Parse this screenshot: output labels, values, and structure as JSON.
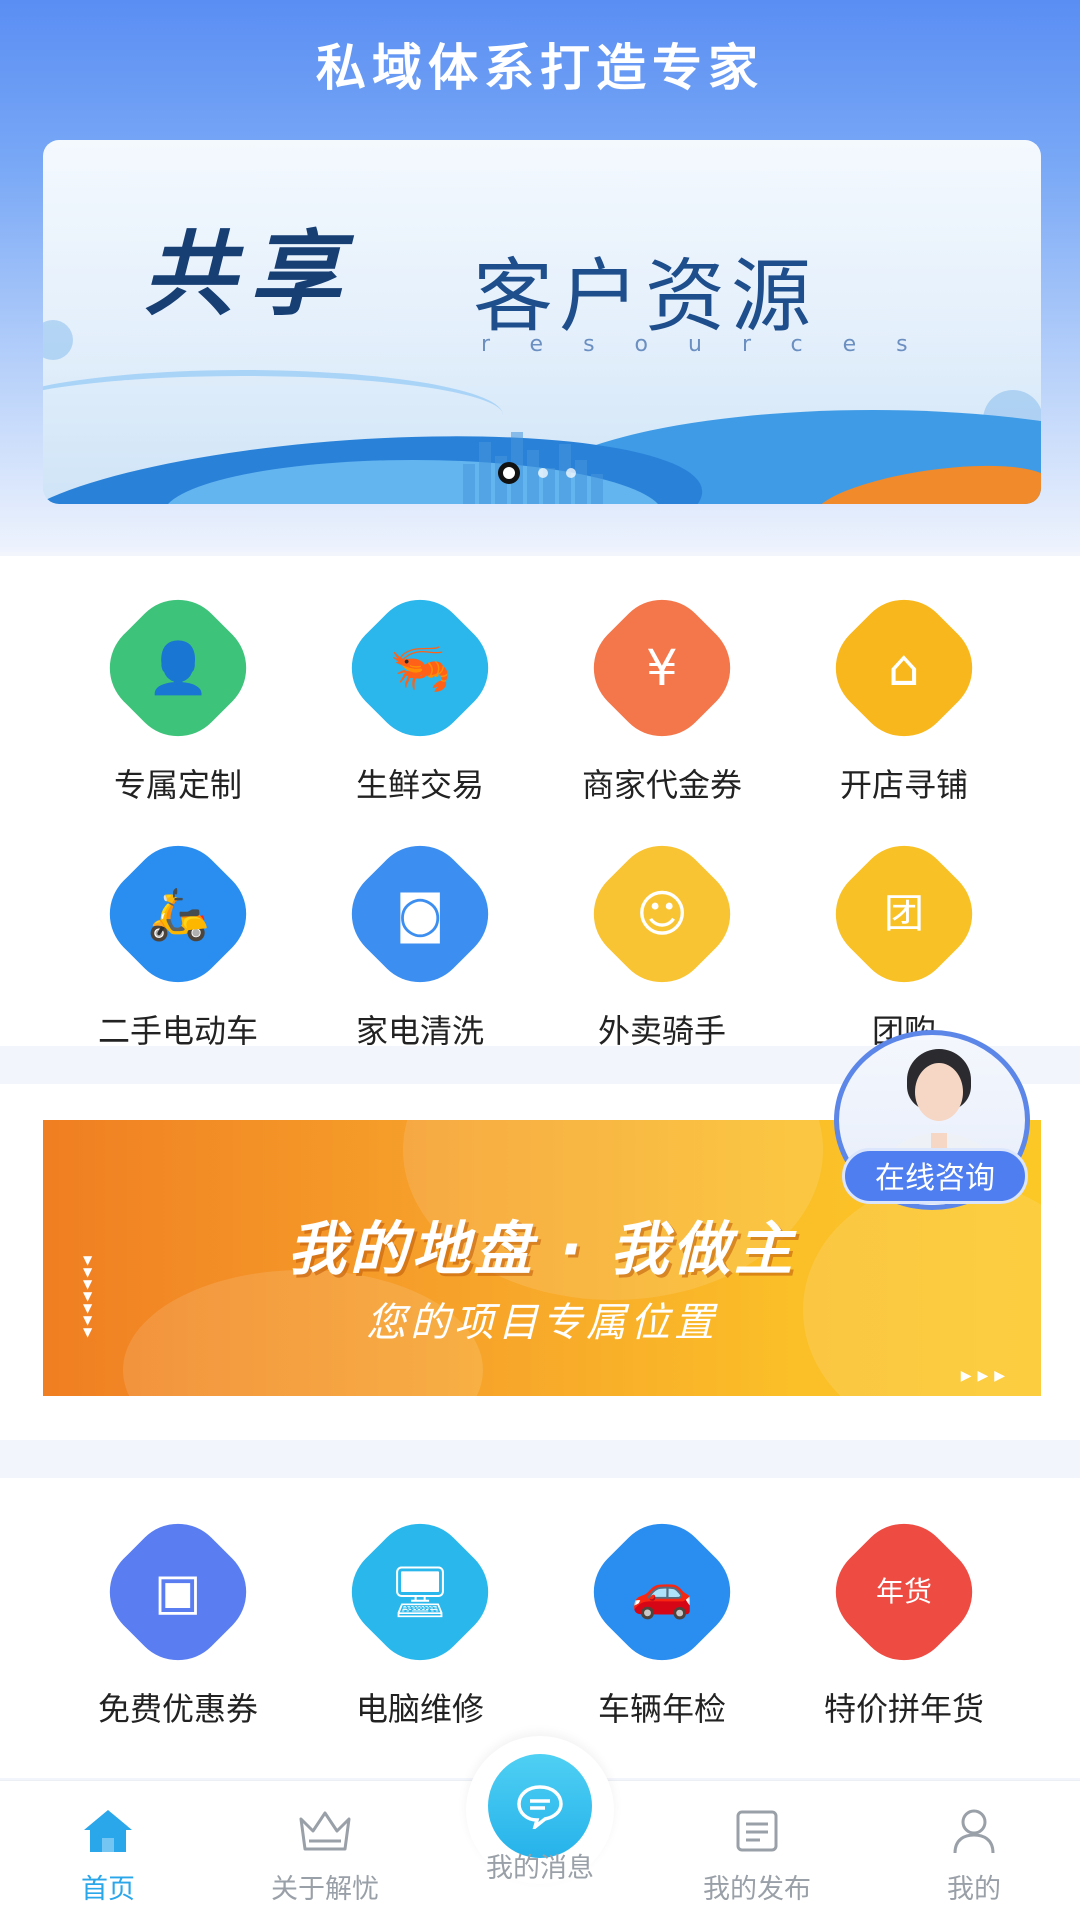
{
  "header": {
    "title": "私域体系打造专家"
  },
  "banner": {
    "script_text": "共享",
    "main_text": "客户资源",
    "sub_text": "resources",
    "dots": [
      {
        "active": true
      },
      {
        "active": false
      },
      {
        "active": false
      }
    ]
  },
  "grid_top": [
    {
      "label": "专属定制",
      "icon": "customer-service-person-icon",
      "color": "#3ec37a",
      "glyph": "👤"
    },
    {
      "label": "生鲜交易",
      "icon": "shrimp-icon",
      "color": "#2bb6ec",
      "glyph": "🦐"
    },
    {
      "label": "商家代金券",
      "icon": "voucher-icon",
      "color": "#f4774b",
      "glyph": "¥"
    },
    {
      "label": "开店寻铺",
      "icon": "shop-icon",
      "color": "#f8b81d",
      "glyph": "⌂"
    },
    {
      "label": "二手电动车",
      "icon": "scooter-icon",
      "color": "#2a8ef0",
      "glyph": "🛵"
    },
    {
      "label": "家电清洗",
      "icon": "washing-machine-icon",
      "color": "#3c8ff0",
      "glyph": "◙"
    },
    {
      "label": "外卖骑手",
      "icon": "delivery-rider-icon",
      "color": "#f9c433",
      "glyph": "☺"
    },
    {
      "label": "团购",
      "icon": "shopping-bag-icon",
      "color": "#f8c126",
      "glyph": "团"
    }
  ],
  "promo": {
    "title": "我的地盘 · 我做主",
    "subtitle": "您的项目专属位置"
  },
  "consult": {
    "label": "在线咨询"
  },
  "grid_bottom": [
    {
      "label": "免费优惠券",
      "icon": "gift-box-icon",
      "color": "#5a7ef2",
      "glyph": "▣"
    },
    {
      "label": "电脑维修",
      "icon": "computer-repair-icon",
      "color": "#2ab8ec",
      "glyph": "🖥"
    },
    {
      "label": "车辆年检",
      "icon": "car-inspection-icon",
      "color": "#2a8ef0",
      "glyph": "🚗"
    },
    {
      "label": "特价拼年货",
      "icon": "new-year-goods-bag-icon",
      "color": "#ee4b43",
      "glyph": "年货"
    }
  ],
  "tabbar": {
    "items": [
      {
        "label": "首页",
        "icon": "home-icon",
        "active": true
      },
      {
        "label": "关于解忧",
        "icon": "crown-icon",
        "active": false
      },
      {
        "label": "我的消息",
        "icon": "chat-bubble-icon",
        "active": false
      },
      {
        "label": "我的发布",
        "icon": "document-list-icon",
        "active": false
      },
      {
        "label": "我的",
        "icon": "user-icon",
        "active": false
      }
    ],
    "active_color": "#2aa6ea",
    "inactive_color": "#9aa0a8"
  }
}
